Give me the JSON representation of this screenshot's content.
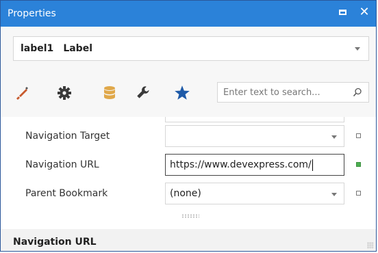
{
  "window": {
    "title": "Properties"
  },
  "selector": {
    "component_name": "label1",
    "component_type": "Label"
  },
  "toolbar": {
    "icons": [
      "brush-icon",
      "gear-icon",
      "database-icon",
      "wrench-icon",
      "star-icon"
    ],
    "active": "wrench-icon"
  },
  "search": {
    "placeholder": "Enter text to search..."
  },
  "properties": [
    {
      "label": "Navigation Target",
      "value": "",
      "has_dropdown": true,
      "modified": false
    },
    {
      "label": "Navigation URL",
      "value": "https://www.devexpress.com/",
      "has_dropdown": false,
      "modified": true
    },
    {
      "label": "Parent Bookmark",
      "value": "(none)",
      "has_dropdown": true,
      "modified": false
    }
  ],
  "description": {
    "title": "Navigation URL"
  },
  "colors": {
    "titlebar": "#2b82d9",
    "brush": "#c85a2d",
    "database": "#e0a84a",
    "star": "#1e5aa8",
    "modified_marker": "#4caf50"
  }
}
